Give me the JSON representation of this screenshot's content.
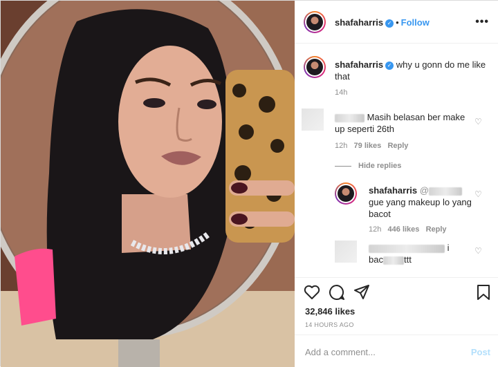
{
  "post": {
    "username": "shafaharris",
    "follow_label": "Follow",
    "separator": "•",
    "more_icon": "more-options-icon",
    "caption": "why u gonn do me like that",
    "caption_time": "14h"
  },
  "comments": [
    {
      "visible_text": "Masih belasan ber make up seperti 26th",
      "username_prefix": "ayudz",
      "time": "12h",
      "likes": "79 likes",
      "reply_label": "Reply"
    }
  ],
  "hide_replies_label": "Hide replies",
  "replies": [
    {
      "username": "shafaharris",
      "mention_prefix": "@",
      "text": "gue yang makeup lo yang bacot",
      "time": "12h",
      "likes": "446 likes",
      "reply_label": "Reply"
    },
    {
      "text_suffix_1": "i",
      "text_part": "bac",
      "text_end": "ttt"
    }
  ],
  "actions": {
    "like_icon": "heart-icon",
    "comment_icon": "comment-icon",
    "share_icon": "share-icon",
    "save_icon": "bookmark-icon"
  },
  "likes_count": "32,846 likes",
  "timestamp": "14 HOURS AGO",
  "add_comment": {
    "placeholder": "Add a comment...",
    "post_label": "Post"
  },
  "colors": {
    "accent": "#3897f0",
    "muted": "#8e8e8e",
    "post_disabled": "#b2dffc"
  }
}
